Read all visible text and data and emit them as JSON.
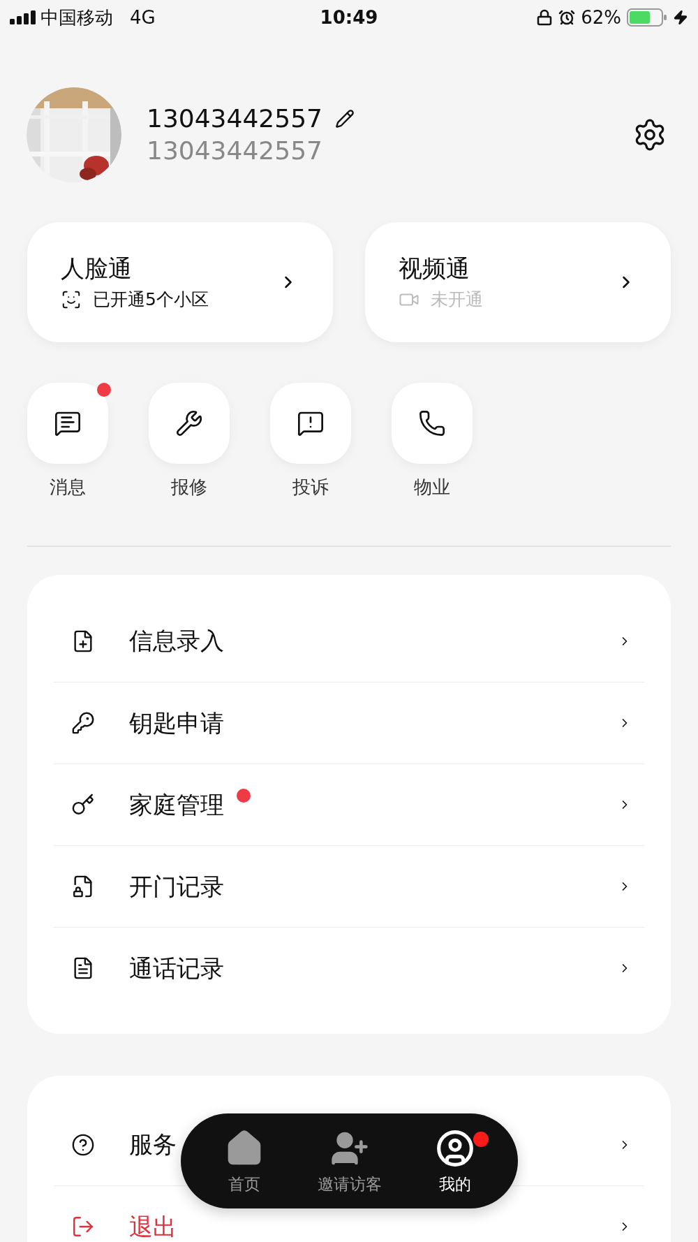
{
  "status_bar": {
    "carrier": "中国移动",
    "network": "4G",
    "time": "10:49",
    "battery": "62%"
  },
  "profile": {
    "name": "13043442557",
    "phone": "13043442557"
  },
  "cards": [
    {
      "kind": "face",
      "title": "人脸通",
      "status": "已开通5个小区",
      "enabled": true
    },
    {
      "kind": "video",
      "title": "视频通",
      "status": "未开通",
      "enabled": false
    }
  ],
  "shortcuts": [
    {
      "kind": "message",
      "label": "消息",
      "badge": true
    },
    {
      "kind": "repair",
      "label": "报修",
      "badge": false
    },
    {
      "kind": "complaint",
      "label": "投诉",
      "badge": false
    },
    {
      "kind": "property",
      "label": "物业",
      "badge": false
    }
  ],
  "menu": [
    {
      "kind": "info",
      "label": "信息录入",
      "badge": false
    },
    {
      "kind": "key",
      "label": "钥匙申请",
      "badge": false
    },
    {
      "kind": "family",
      "label": "家庭管理",
      "badge": true
    },
    {
      "kind": "door",
      "label": "开门记录",
      "badge": false
    },
    {
      "kind": "call",
      "label": "通话记录",
      "badge": false
    }
  ],
  "menu_2": [
    {
      "kind": "help",
      "label": "服务",
      "danger": false
    },
    {
      "kind": "exit",
      "label": "退出",
      "danger": true
    }
  ],
  "tab_bar": [
    {
      "kind": "home",
      "label": "首页",
      "selected": false,
      "badge": false
    },
    {
      "kind": "invite",
      "label": "邀请访客",
      "selected": false,
      "badge": false
    },
    {
      "kind": "me",
      "label": "我的",
      "selected": true,
      "badge": true
    }
  ]
}
